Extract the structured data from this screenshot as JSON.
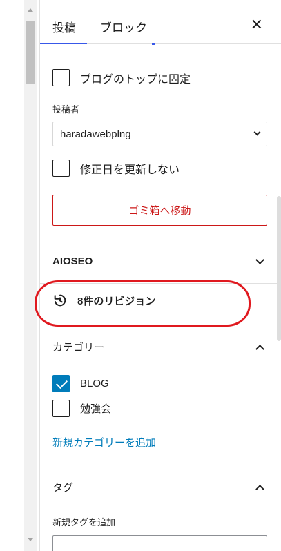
{
  "tabs": {
    "posts": "投稿",
    "block": "ブロック"
  },
  "close_symbol": "✕",
  "sticky": {
    "label": "ブログのトップに固定",
    "checked": false
  },
  "author": {
    "label": "投稿者",
    "value": "haradawebplng"
  },
  "no_update_date": {
    "label": "修正日を更新しない",
    "checked": false
  },
  "trash_button": "ゴミ箱へ移動",
  "aioseo": {
    "title": "AIOSEO"
  },
  "revisions": {
    "label": "8件のリビジョン"
  },
  "categories": {
    "title": "カテゴリー",
    "items": [
      {
        "label": "BLOG",
        "checked": true
      },
      {
        "label": "勉強会",
        "checked": false
      }
    ],
    "add_link": "新規カテゴリーを追加"
  },
  "tags": {
    "title": "タグ",
    "add_label": "新規タグを追加"
  },
  "colors": {
    "accent": "#007cba",
    "danger": "#cc1818",
    "annotation": "#e0191f",
    "tab_indicator": "#3858e9"
  }
}
